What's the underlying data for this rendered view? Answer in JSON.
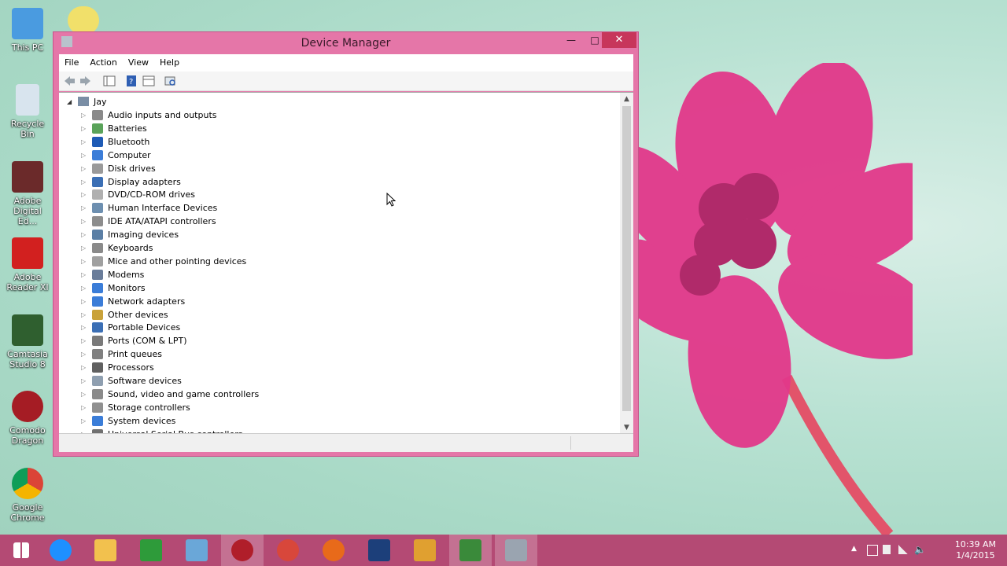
{
  "desktop": {
    "icons": [
      {
        "label": "This PC"
      },
      {
        "label": "Recycle Bin"
      },
      {
        "label": "Adobe Digital Ed..."
      },
      {
        "label": "Adobe Reader XI"
      },
      {
        "label": "Camtasia Studio 8"
      },
      {
        "label": "Comodo Dragon"
      },
      {
        "label": "Google Chrome"
      }
    ]
  },
  "window": {
    "title": "Device Manager",
    "menu": [
      "File",
      "Action",
      "View",
      "Help"
    ],
    "tree": {
      "root": "Jay",
      "items": [
        {
          "label": "Audio inputs and outputs",
          "color": "#8a8a8a"
        },
        {
          "label": "Batteries",
          "color": "#5aa35a"
        },
        {
          "label": "Bluetooth",
          "color": "#1e5bb5"
        },
        {
          "label": "Computer",
          "color": "#3b7dd8"
        },
        {
          "label": "Disk drives",
          "color": "#9a9a9a"
        },
        {
          "label": "Display adapters",
          "color": "#3b6fb5"
        },
        {
          "label": "DVD/CD-ROM drives",
          "color": "#b0b0b0"
        },
        {
          "label": "Human Interface Devices",
          "color": "#6d8fb0"
        },
        {
          "label": "IDE ATA/ATAPI controllers",
          "color": "#8d8d8d"
        },
        {
          "label": "Imaging devices",
          "color": "#5b7fa5"
        },
        {
          "label": "Keyboards",
          "color": "#8a8a8a"
        },
        {
          "label": "Mice and other pointing devices",
          "color": "#a0a0a0"
        },
        {
          "label": "Modems",
          "color": "#6a7d9a"
        },
        {
          "label": "Monitors",
          "color": "#3b7dd8"
        },
        {
          "label": "Network adapters",
          "color": "#3b7dd8"
        },
        {
          "label": "Other devices",
          "color": "#c9a23a"
        },
        {
          "label": "Portable Devices",
          "color": "#3b6fb5"
        },
        {
          "label": "Ports (COM & LPT)",
          "color": "#7a7a7a"
        },
        {
          "label": "Print queues",
          "color": "#808080"
        },
        {
          "label": "Processors",
          "color": "#606060"
        },
        {
          "label": "Software devices",
          "color": "#8f9fb0"
        },
        {
          "label": "Sound, video and game controllers",
          "color": "#8a8a8a"
        },
        {
          "label": "Storage controllers",
          "color": "#909090"
        },
        {
          "label": "System devices",
          "color": "#3b7dd8"
        },
        {
          "label": "Universal Serial Bus controllers",
          "color": "#707070"
        }
      ]
    }
  },
  "taskbar": {
    "apps": [
      {
        "name": "start-button",
        "color": "#ffffff"
      },
      {
        "name": "internet-explorer-icon",
        "color": "#1e90ff"
      },
      {
        "name": "file-explorer-icon",
        "color": "#f2c14e"
      },
      {
        "name": "store-icon",
        "color": "#2e9b3a"
      },
      {
        "name": "paint-icon",
        "color": "#6aa7d8"
      },
      {
        "name": "comodo-dragon-icon",
        "color": "#b01e2a"
      },
      {
        "name": "chrome-icon",
        "color": "#d8473b"
      },
      {
        "name": "firefox-icon",
        "color": "#e86a1a"
      },
      {
        "name": "photoshop-icon",
        "color": "#1c3f7a"
      },
      {
        "name": "outlook-icon",
        "color": "#e0a030"
      },
      {
        "name": "camtasia-icon",
        "color": "#3a8a3a"
      },
      {
        "name": "device-manager-icon",
        "color": "#9aa4b0"
      }
    ],
    "clock": {
      "time": "10:39 AM",
      "date": "1/4/2015"
    }
  }
}
